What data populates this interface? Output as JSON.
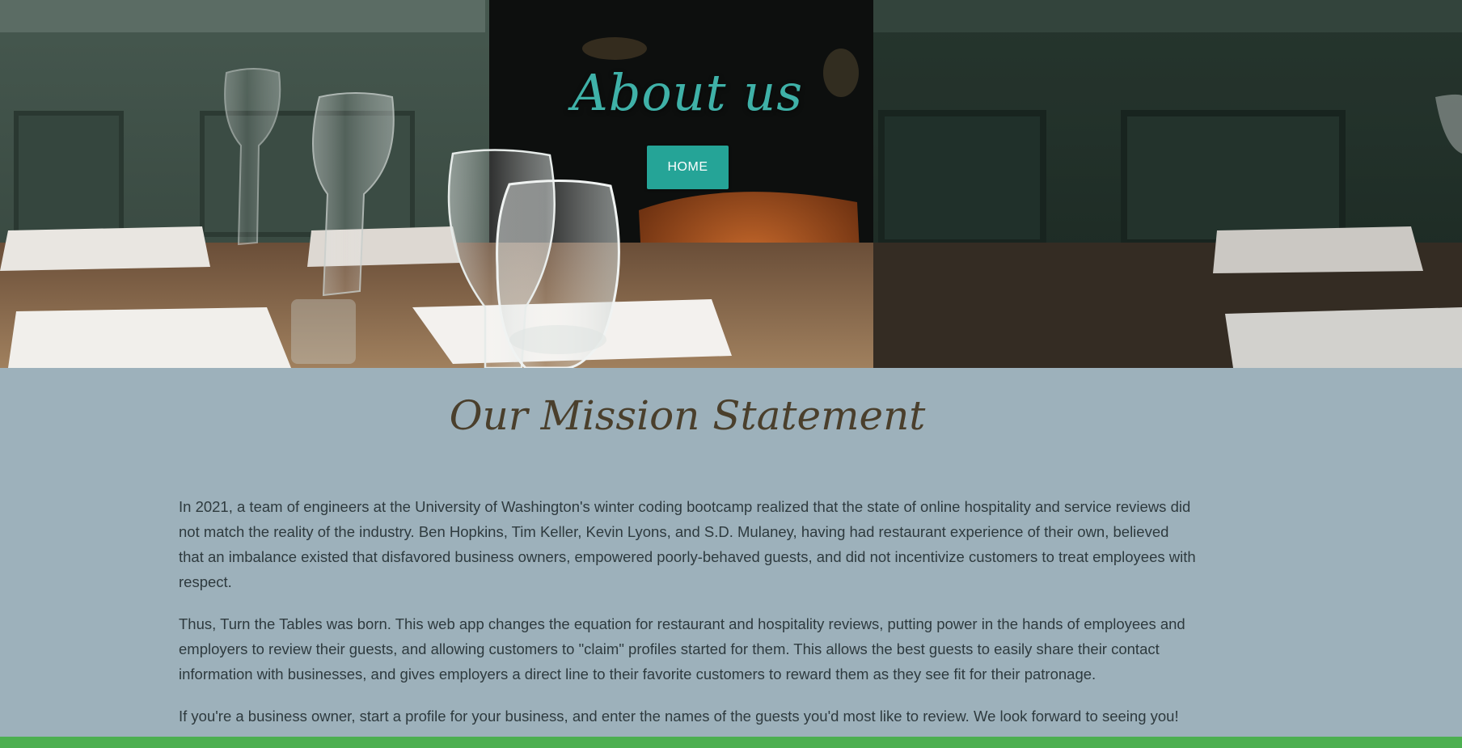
{
  "hero": {
    "title": "About us",
    "home_button_label": "HOME",
    "background_image": "restaurant-wine-glasses-photo"
  },
  "mission": {
    "title": "Our Mission Statement",
    "paragraphs": [
      "In 2021, a team of engineers at the University of Washington's winter coding bootcamp realized that the state of online hospitality and service reviews did not match the reality of the industry. Ben Hopkins, Tim Keller, Kevin Lyons, and S.D. Mulaney, having had restaurant experience of their own, believed that an imbalance existed that disfavored business owners, empowered poorly-behaved guests, and did not incentivize customers to treat employees with respect.",
      "Thus, Turn the Tables was born. This web app changes the equation for restaurant and hospitality reviews, putting power in the hands of employees and employers to review their guests, and allowing customers to \"claim\" profiles started for them. This allows the best guests to easily share their contact information with businesses, and gives employers a direct line to their favorite customers to reward them as they see fit for their patronage.",
      "If you're a business owner, start a profile for your business, and enter the names of the guests you'd most like to review. We look forward to seeing you!"
    ]
  },
  "colors": {
    "accent_teal": "#25a497",
    "title_teal": "#3fb1a8",
    "mission_background": "#9db1bb",
    "mission_title": "#4a3f2c",
    "footer_green": "#4caf50"
  }
}
